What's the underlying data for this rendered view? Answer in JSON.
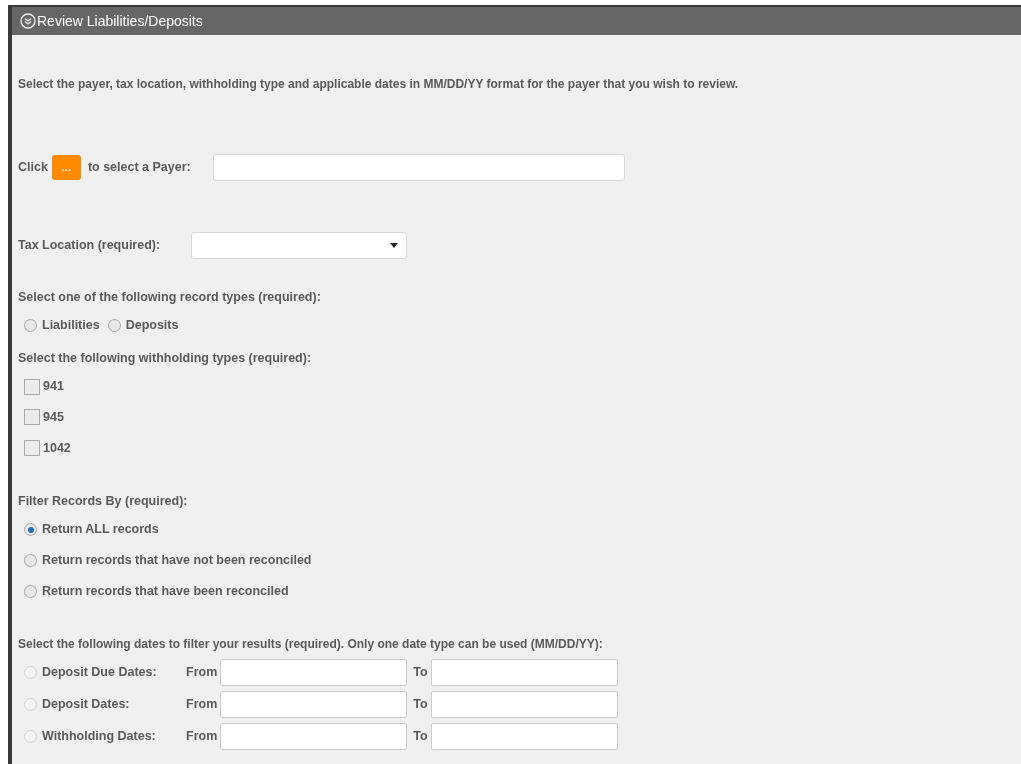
{
  "panel": {
    "title": "Review Liabilities/Deposits"
  },
  "instructions": "Select the payer, tax location, withholding type and applicable dates in MM/DD/YY format for the payer that you wish to review.",
  "payer": {
    "prefix": "Click",
    "button": "...",
    "suffix": "to select a Payer:"
  },
  "tax_location": {
    "label": "Tax Location (required):"
  },
  "record_types": {
    "label": "Select one of the following record types (required):",
    "options": [
      {
        "label": "Liabilities",
        "selected": false
      },
      {
        "label": "Deposits",
        "selected": false
      }
    ]
  },
  "withholding_types": {
    "label": "Select the following withholding types (required):",
    "options": [
      {
        "label": "941",
        "checked": false
      },
      {
        "label": "945",
        "checked": false
      },
      {
        "label": "1042",
        "checked": false
      }
    ]
  },
  "filter": {
    "label": "Filter Records By (required):",
    "options": [
      {
        "label": "Return ALL records",
        "selected": true
      },
      {
        "label": "Return records that have not been reconciled",
        "selected": false
      },
      {
        "label": "Return records that have been reconciled",
        "selected": false
      }
    ]
  },
  "dates": {
    "label": "Select the following dates to filter your results (required). Only one date type can be used (MM/DD/YY):",
    "rows": [
      {
        "label": "Deposit Due Dates:",
        "from": "From",
        "to": "To",
        "selected": false,
        "disabled": true
      },
      {
        "label": "Deposit Dates:",
        "from": "From",
        "to": "To",
        "selected": false,
        "disabled": true
      },
      {
        "label": "Withholding Dates:",
        "from": "From",
        "to": "To",
        "selected": false,
        "disabled": true
      }
    ]
  }
}
